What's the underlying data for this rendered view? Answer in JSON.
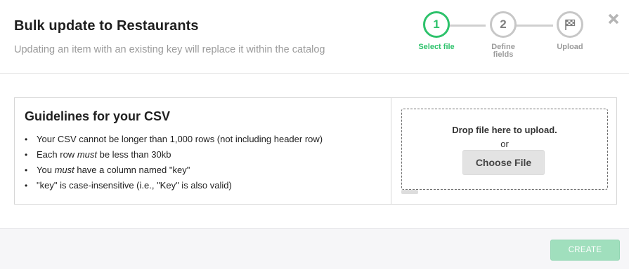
{
  "header": {
    "title": "Bulk update to Restaurants",
    "subtitle": "Updating an item with an existing key will replace it within the catalog"
  },
  "stepper": {
    "steps": [
      {
        "number": "1",
        "label": "Select file",
        "active": true
      },
      {
        "number": "2",
        "label": "Define fields",
        "active": false
      },
      {
        "number": "",
        "label": "Upload",
        "icon": "flag-icon",
        "active": false
      }
    ],
    "active_color": "#2dc26b",
    "inactive_color": "#c7c7c7"
  },
  "close_icon": "close-icon",
  "guidelines": {
    "title": "Guidelines for your CSV",
    "items": [
      {
        "before": "Your CSV cannot be longer than 1,000 rows (not including header row)",
        "em": "",
        "after": ""
      },
      {
        "before": "Each row ",
        "em": "must",
        "after": " be less than 30kb"
      },
      {
        "before": "You ",
        "em": "must",
        "after": " have a column named \"key\""
      },
      {
        "before": "\"key\" is case-insensitive (i.e., \"Key\" is also valid)",
        "em": "",
        "after": ""
      }
    ]
  },
  "dropzone": {
    "text": "Drop file here to upload.",
    "or": "or",
    "button_label": "Choose File"
  },
  "footer": {
    "create_label": "CREATE",
    "create_color": "#a0dfbd"
  }
}
